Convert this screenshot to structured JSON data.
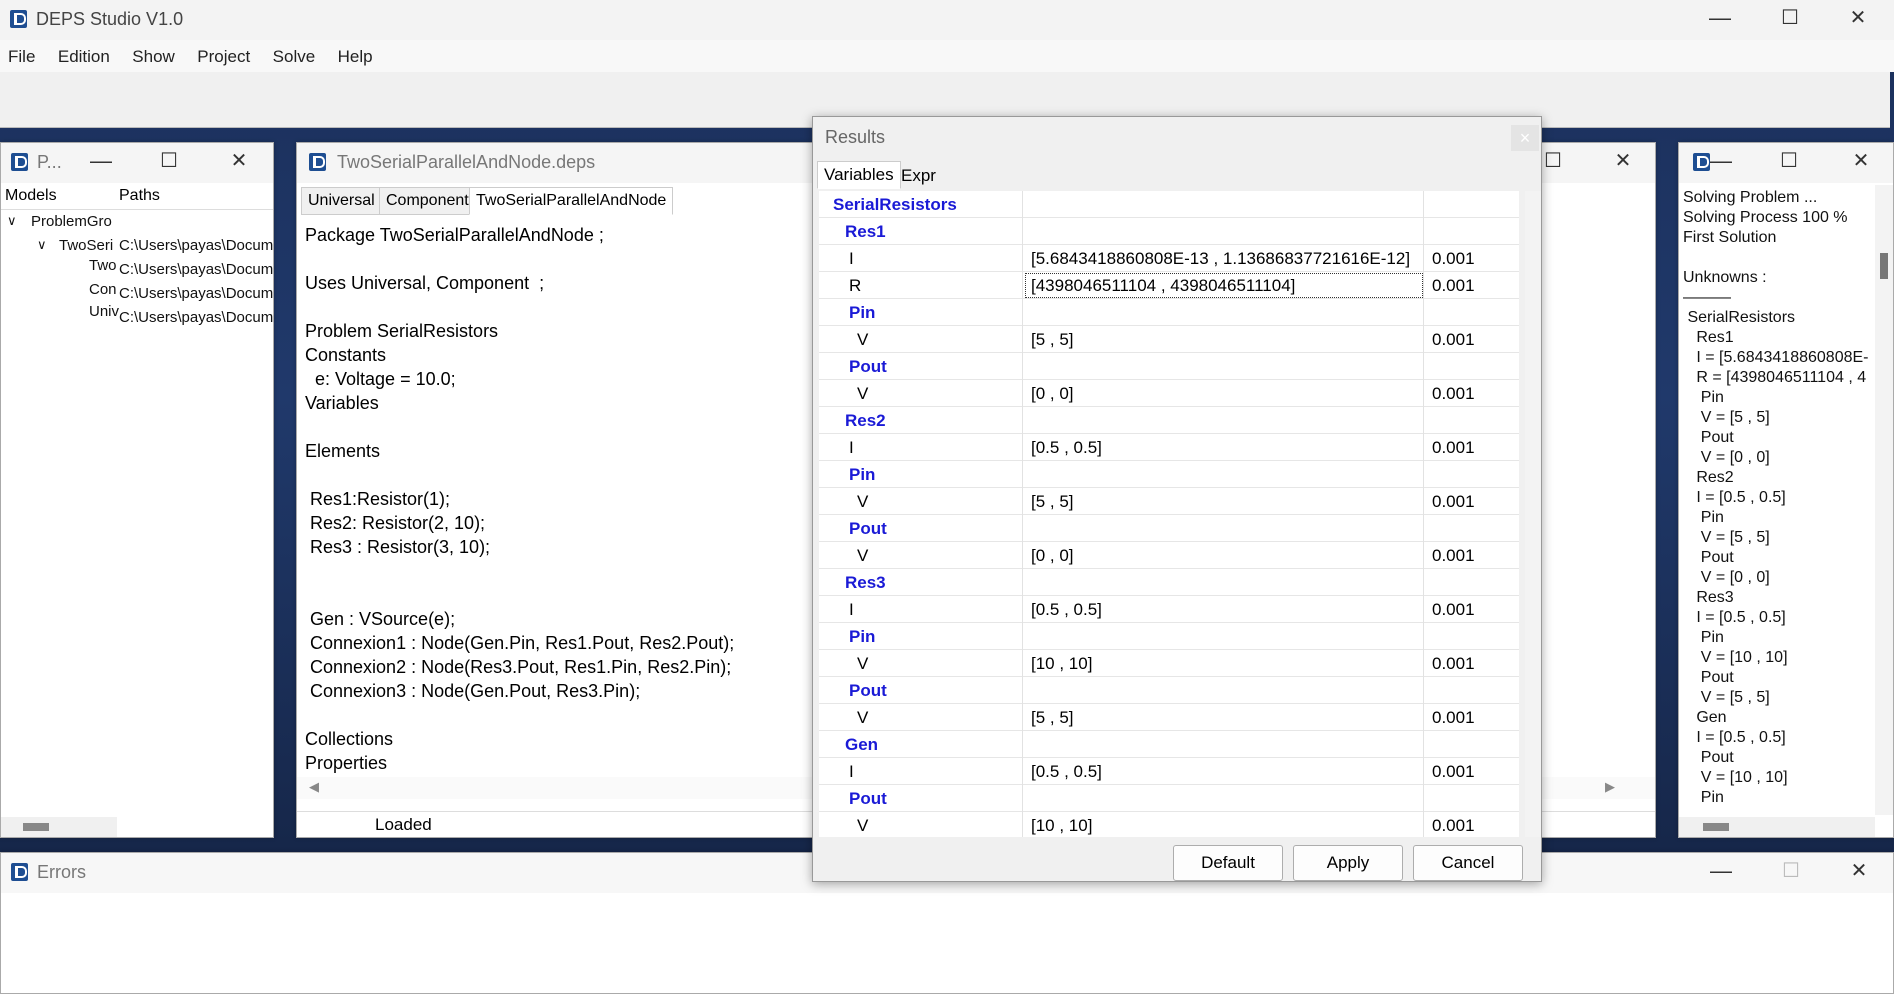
{
  "main": {
    "title": "DEPS Studio V1.0",
    "menu": [
      "File",
      "Edition",
      "Show",
      "Project",
      "Solve",
      "Help"
    ]
  },
  "models_window": {
    "title": "P...",
    "tabs": [
      "Models",
      "Paths"
    ],
    "tree": [
      {
        "name": "ProblemGro",
        "path": ""
      },
      {
        "name": "TwoSeri",
        "path": "C:\\Users\\payas\\Docum"
      },
      {
        "name": "Two",
        "path": "C:\\Users\\payas\\Docum"
      },
      {
        "name": "Con",
        "path": "C:\\Users\\payas\\Docum"
      },
      {
        "name": "Univ",
        "path": "C:\\Users\\payas\\Docum"
      }
    ]
  },
  "editor_window": {
    "title": "TwoSerialParallelAndNode.deps",
    "tabs": [
      "Universal",
      "Component",
      "TwoSerialParallelAndNode"
    ],
    "lines": [
      "Package TwoSerialParallelAndNode ;",
      "",
      "Uses Universal, Component  ;",
      "",
      "Problem SerialResistors",
      "Constants",
      "  e: Voltage = 10.0;",
      "Variables",
      "",
      "Elements",
      "",
      " Res1:Resistor(1);",
      " Res2: Resistor(2, 10);",
      " Res3 : Resistor(3, 10);",
      "",
      "",
      " Gen : VSource(e);",
      " Connexion1 : Node(Gen.Pin, Res1.Pout, Res2.Pout);",
      " Connexion2 : Node(Res3.Pout, Res1.Pin, Res2.Pin);",
      " Connexion3 : Node(Gen.Pout, Res3.Pin);",
      "",
      "Collections",
      "Properties"
    ],
    "status": "Loaded"
  },
  "results": {
    "title": "Results",
    "close_glyph": "×",
    "tabs": [
      "Variables",
      "Expr"
    ],
    "rows": [
      {
        "label": "SerialResistors",
        "indent": 0,
        "group": true,
        "value": "",
        "prec": ""
      },
      {
        "label": "Res1",
        "indent": 1,
        "group": true,
        "value": "",
        "prec": ""
      },
      {
        "label": "I",
        "indent": 2,
        "group": false,
        "value": "[5.6843418860808E-13 , 1.13686837721616E-12]",
        "prec": "0.001"
      },
      {
        "label": "R",
        "indent": 2,
        "group": false,
        "value": "[4398046511104 , 4398046511104]",
        "prec": "0.001",
        "selected": true
      },
      {
        "label": "Pin",
        "indent": 2,
        "group": true,
        "value": "",
        "prec": ""
      },
      {
        "label": "V",
        "indent": 3,
        "group": false,
        "value": "[5 , 5]",
        "prec": "0.001"
      },
      {
        "label": "Pout",
        "indent": 2,
        "group": true,
        "value": "",
        "prec": ""
      },
      {
        "label": "V",
        "indent": 3,
        "group": false,
        "value": "[0 , 0]",
        "prec": "0.001"
      },
      {
        "label": "Res2",
        "indent": 1,
        "group": true,
        "value": "",
        "prec": ""
      },
      {
        "label": "I",
        "indent": 2,
        "group": false,
        "value": "[0.5 , 0.5]",
        "prec": "0.001"
      },
      {
        "label": "Pin",
        "indent": 2,
        "group": true,
        "value": "",
        "prec": ""
      },
      {
        "label": "V",
        "indent": 3,
        "group": false,
        "value": "[5 , 5]",
        "prec": "0.001"
      },
      {
        "label": "Pout",
        "indent": 2,
        "group": true,
        "value": "",
        "prec": ""
      },
      {
        "label": "V",
        "indent": 3,
        "group": false,
        "value": "[0 , 0]",
        "prec": "0.001"
      },
      {
        "label": "Res3",
        "indent": 1,
        "group": true,
        "value": "",
        "prec": ""
      },
      {
        "label": "I",
        "indent": 2,
        "group": false,
        "value": "[0.5 , 0.5]",
        "prec": "0.001"
      },
      {
        "label": "Pin",
        "indent": 2,
        "group": true,
        "value": "",
        "prec": ""
      },
      {
        "label": "V",
        "indent": 3,
        "group": false,
        "value": "[10 , 10]",
        "prec": "0.001"
      },
      {
        "label": "Pout",
        "indent": 2,
        "group": true,
        "value": "",
        "prec": ""
      },
      {
        "label": "V",
        "indent": 3,
        "group": false,
        "value": "[5 , 5]",
        "prec": "0.001"
      },
      {
        "label": "Gen",
        "indent": 1,
        "group": true,
        "value": "",
        "prec": ""
      },
      {
        "label": "I",
        "indent": 2,
        "group": false,
        "value": "[0.5 , 0.5]",
        "prec": "0.001"
      },
      {
        "label": "Pout",
        "indent": 2,
        "group": true,
        "value": "",
        "prec": ""
      },
      {
        "label": "V",
        "indent": 3,
        "group": false,
        "value": "[10 , 10]",
        "prec": "0.001"
      }
    ],
    "buttons": {
      "default": "Default",
      "apply": "Apply",
      "cancel": "Cancel"
    }
  },
  "log_window": {
    "lines": [
      "Solving Problem ...",
      "Solving Process 100 %",
      "First Solution",
      "",
      "Unknowns :",
      "———",
      " SerialResistors",
      "   Res1",
      "   I = [5.6843418860808E-",
      "   R = [4398046511104 , 4",
      "    Pin",
      "    V = [5 , 5]",
      "    Pout",
      "    V = [0 , 0]",
      "   Res2",
      "   I = [0.5 , 0.5]",
      "    Pin",
      "    V = [5 , 5]",
      "    Pout",
      "    V = [0 , 0]",
      "   Res3",
      "   I = [0.5 , 0.5]",
      "    Pin",
      "    V = [10 , 10]",
      "    Pout",
      "    V = [5 , 5]",
      "   Gen",
      "   I = [0.5 , 0.5]",
      "    Pout",
      "    V = [10 , 10]",
      "    Pin"
    ]
  },
  "errors_window": {
    "title": "Errors"
  },
  "colors": {
    "group_label": "#1a1ad6"
  }
}
